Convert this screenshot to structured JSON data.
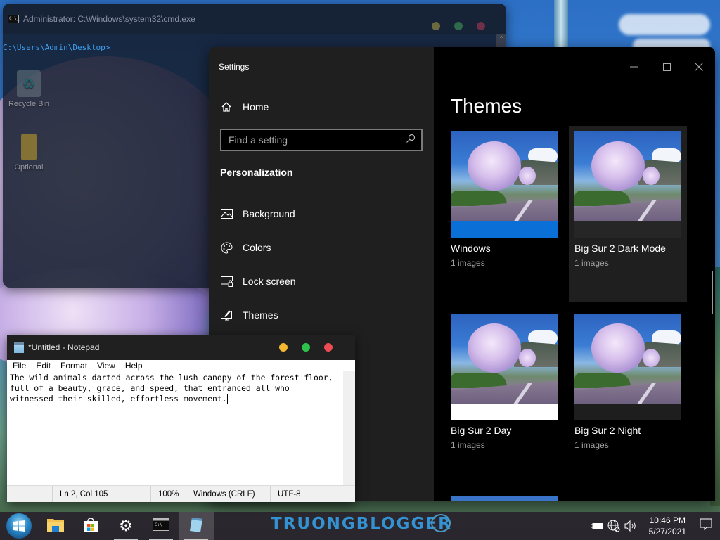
{
  "desktop": {
    "icons": [
      {
        "label": "Recycle Bin",
        "icon": "recycle-bin-icon"
      },
      {
        "label": "Optional",
        "icon": "folder-icon"
      }
    ]
  },
  "cmd": {
    "title": "Administrator: C:\\Windows\\system32\\cmd.exe",
    "icon_text": "C:\\_",
    "prompt": "C:\\Users\\Admin\\Desktop>",
    "traffic_colors": {
      "minimize": "#6b6a3e",
      "maximize": "#2f6a4a",
      "close": "#6e3048"
    }
  },
  "settings": {
    "window_title": "Settings",
    "home_label": "Home",
    "search_placeholder": "Find a setting",
    "section_heading": "Personalization",
    "nav_items": [
      {
        "label": "Background",
        "icon": "image-icon"
      },
      {
        "label": "Colors",
        "icon": "palette-icon"
      },
      {
        "label": "Lock screen",
        "icon": "lock-screen-icon"
      },
      {
        "label": "Themes",
        "icon": "themes-icon"
      }
    ],
    "controls": {
      "minimize": "—",
      "maximize": "☐",
      "close": "✕"
    },
    "page_heading": "Themes",
    "themes": [
      {
        "name": "Windows",
        "count": "1 images",
        "accent": "#0a6fd6",
        "selected": false
      },
      {
        "name": "Big Sur 2 Dark Mode",
        "count": "1 images",
        "accent": "#1f1f1f",
        "selected": true
      },
      {
        "name": "Big Sur 2 Day",
        "count": "1 images",
        "accent": "#ffffff",
        "selected": false
      },
      {
        "name": "Big Sur 2 Night",
        "count": "1 images",
        "accent": "#1e1e1e",
        "selected": false
      }
    ]
  },
  "notepad": {
    "title": "*Untitled - Notepad",
    "menu": [
      "File",
      "Edit",
      "Format",
      "View",
      "Help"
    ],
    "content": "The wild animals darted across the lush canopy of the forest floor,\nfull of a beauty, grace, and speed, that entranced all who\nwitnessed their skilled, effortless movement.",
    "status": {
      "position": "Ln 2, Col 105",
      "zoom": "100%",
      "line_ending": "Windows (CRLF)",
      "encoding": "UTF-8"
    },
    "traffic_colors": {
      "minimize": "#f5b731",
      "maximize": "#2dc24a",
      "close": "#ef4b55"
    }
  },
  "taskbar": {
    "apps": [
      {
        "name": "File Explorer",
        "icon": "file-explorer-icon"
      },
      {
        "name": "Microsoft Store",
        "icon": "store-icon"
      },
      {
        "name": "Settings",
        "icon": "gear-icon"
      },
      {
        "name": "Command Prompt",
        "icon": "cmd-icon"
      },
      {
        "name": "Notepad",
        "icon": "notepad-icon"
      }
    ],
    "watermark": "TRUONGBLOGGER",
    "time": "10:46 PM",
    "date": "5/27/2021"
  }
}
